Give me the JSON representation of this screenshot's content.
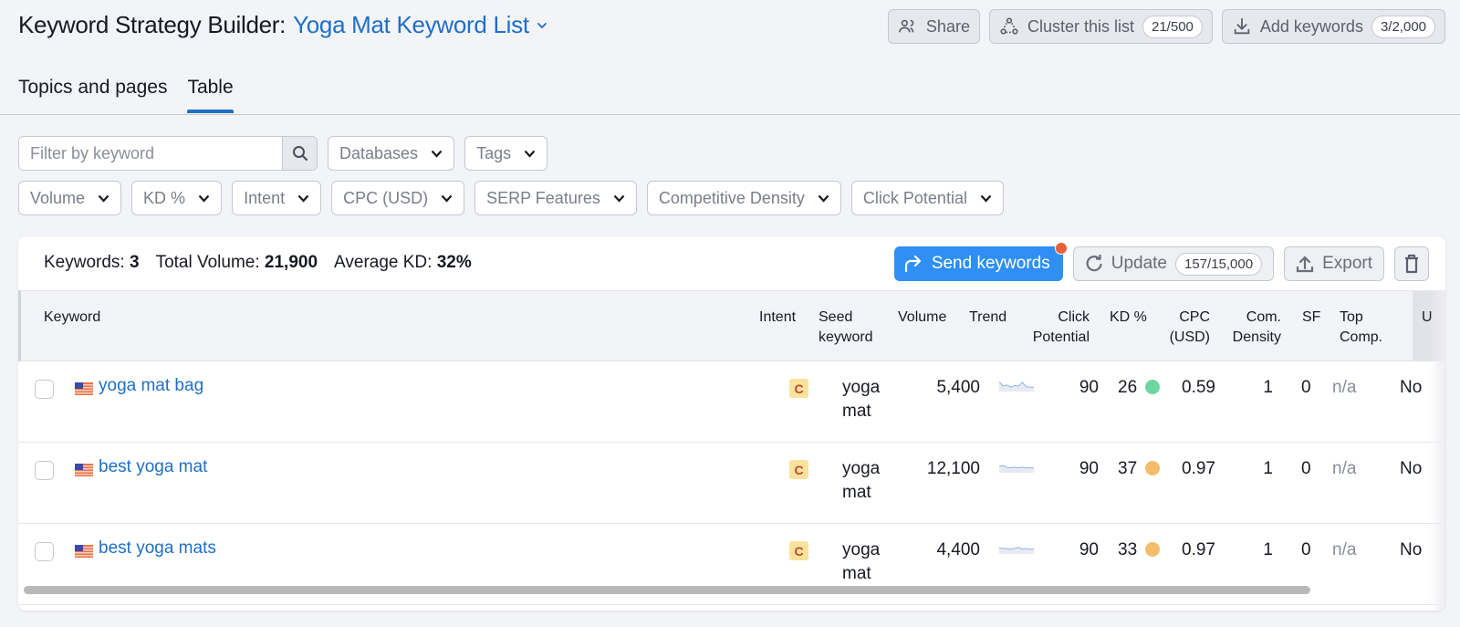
{
  "header": {
    "title_prefix": "Keyword Strategy Builder:",
    "list_name": "Yoga Mat Keyword List",
    "actions": [
      {
        "label": "Share",
        "icon": "users-icon"
      },
      {
        "label": "Cluster this list",
        "icon": "cluster-icon",
        "count": "21/500"
      },
      {
        "label": "Add keywords",
        "icon": "download-icon",
        "count": "3/2,000"
      }
    ]
  },
  "tabs": [
    {
      "label": "Topics and pages",
      "active": false
    },
    {
      "label": "Table",
      "active": true
    }
  ],
  "filters": {
    "search_placeholder": "Filter by keyword",
    "search_value": "",
    "row1": [
      "Databases",
      "Tags"
    ],
    "row2": [
      "Volume",
      "KD %",
      "Intent",
      "CPC (USD)",
      "SERP Features",
      "Competitive Density",
      "Click Potential"
    ]
  },
  "summary": {
    "keywords_label": "Keywords:",
    "keywords_value": "3",
    "volume_label": "Total Volume:",
    "volume_value": "21,900",
    "kd_label": "Average KD:",
    "kd_value": "32%"
  },
  "card_actions": {
    "send_label": "Send keywords",
    "update_label": "Update",
    "update_count": "157/15,000",
    "export_label": "Export",
    "delete_icon": "trash-icon"
  },
  "table": {
    "columns": {
      "keyword": "Keyword",
      "intent": "Intent",
      "seed": "Seed\nkeyword",
      "volume": "Volume",
      "trend": "Trend",
      "click_potential": "Click\nPotential",
      "kd": "KD %",
      "cpc": "CPC\n(USD)",
      "com_density": "Com.\nDensity",
      "sf": "SF",
      "top_comp": "Top\nComp.",
      "u": "U"
    },
    "rows": [
      {
        "keyword": "yoga mat bag",
        "flag": "us-flag",
        "intent": "C",
        "seed": "yoga\nmat",
        "volume": "5,400",
        "click_potential": "90",
        "kd": "26",
        "kd_color": "#6fd6a2",
        "cpc": "0.59",
        "com_density": "1",
        "sf": "0",
        "top_comp": "n/a",
        "u": "No",
        "trend": [
          0.9,
          0.5,
          0.6,
          0.4,
          0.55,
          0.5,
          0.85,
          0.45,
          0.4,
          0.4
        ]
      },
      {
        "keyword": "best yoga mat",
        "flag": "us-flag",
        "intent": "C",
        "seed": "yoga\nmat",
        "volume": "12,100",
        "click_potential": "90",
        "kd": "37",
        "kd_color": "#f4bd6c",
        "cpc": "0.97",
        "com_density": "1",
        "sf": "0",
        "top_comp": "n/a",
        "u": "No",
        "trend": [
          0.6,
          0.65,
          0.5,
          0.45,
          0.5,
          0.45,
          0.5,
          0.45,
          0.45,
          0.45
        ]
      },
      {
        "keyword": "best yoga mats",
        "flag": "us-flag",
        "intent": "C",
        "seed": "yoga\nmat",
        "volume": "4,400",
        "click_potential": "90",
        "kd": "33",
        "kd_color": "#f4bd6c",
        "cpc": "0.97",
        "com_density": "1",
        "sf": "0",
        "top_comp": "n/a",
        "u": "No",
        "trend": [
          0.55,
          0.5,
          0.5,
          0.45,
          0.5,
          0.6,
          0.45,
          0.5,
          0.45,
          0.45
        ]
      }
    ]
  },
  "colors": {
    "accent": "#1f6fc8",
    "send_button": "#2f8ff4",
    "notification_dot": "#e5603b",
    "intent_badge_bg": "#fbe29b",
    "intent_badge_text": "#c0492f"
  }
}
